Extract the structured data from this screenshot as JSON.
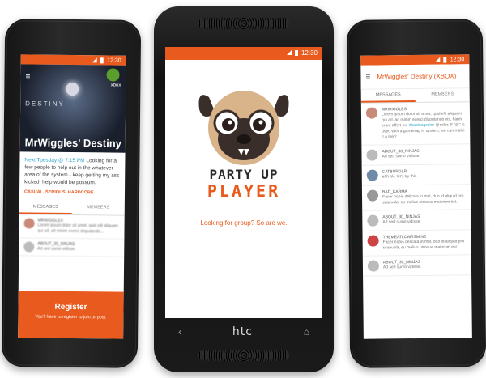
{
  "status": {
    "time": "12:30"
  },
  "left": {
    "hero": {
      "game": "DESTINY",
      "platform": "xbox",
      "group_title": "MrWiggles' Destiny"
    },
    "post": {
      "when": "Next Tuesday @ 7:15 PM",
      "body": " Looking for a few people to help out in the whatever area of the system - keep getting my ass kicked, help would be possum.",
      "tags": "CASUAL, SERIOUS, HARDCORE"
    },
    "tabs": [
      "MESSAGES",
      "MEMBERS"
    ],
    "messages": [
      {
        "name": "MRWIGGLES",
        "text": "Lorem ipsum dolor sit amet, quid elit aliquam qui ad, ad minim exerci disputando..."
      },
      {
        "name": "ABOUT_30_NINJAS",
        "text": "Ad sed sumo vidisse."
      }
    ],
    "register": {
      "button": "Register",
      "sub": "You'll have to register to join or post."
    }
  },
  "middle": {
    "logo_line1": "PARTY UP",
    "logo_line2": "PLAYER",
    "tagline": "Looking for group? So are we.",
    "brand": "htc",
    "nav": {
      "back": "‹",
      "home": "⌂"
    }
  },
  "right": {
    "title": "MrWiggles' Destiny (XBOX)",
    "tabs": [
      "MESSAGES",
      "MEMBERS"
    ],
    "messages": [
      {
        "name": "MRWIGGLES",
        "text": "Lorem ipsum dolor sit amet, quid elit aliquam qui ad, ad minim exerci disputando vis, harm erant affert ex.",
        "link": "#hashtagcolor",
        "text2": "@color. If \"@\" is used with a gamertag in system, we can make it a link?"
      },
      {
        "name": "ABOUT_30_NINJAS",
        "text": "Ad sed sumo vidisse."
      },
      {
        "name": "CATBURGLR",
        "text": "ahh ok, let's try this"
      },
      {
        "name": "BAD_KARMA",
        "text": "Facer nobis delicata in mel, duo id aliquid pro scaevola, eu melius utroque maiorum est."
      },
      {
        "name": "ABOUT_30_NINJAS",
        "text": "Ad sed sumo vidisse."
      },
      {
        "name": "THEMEATLOAFISMINE",
        "text": "Facer nobis delicata in mel, duo id aliquid pro scaevola, eu melius utroque maiorum est."
      },
      {
        "name": "ABOUT_30_NINJAS",
        "text": "Ad sed sumo vidisse."
      }
    ]
  },
  "colors": {
    "accent": "#e85a1e",
    "link": "#2aa6c8"
  }
}
